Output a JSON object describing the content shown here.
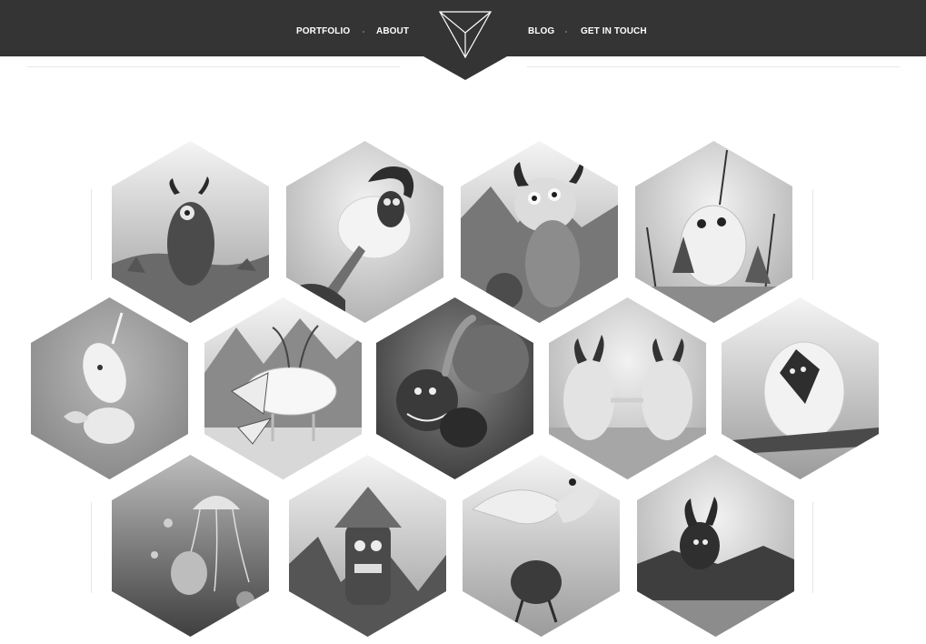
{
  "nav": {
    "portfolio": "PORTFOLIO",
    "about": "ABOUT",
    "blog": "BLOG",
    "contact": "GET IN TOUCH"
  },
  "colors": {
    "header": "#343434",
    "nav_text": "#ffffff",
    "rule": "#e6e6e6"
  },
  "gallery": {
    "style": "grayscale",
    "rows": [
      [
        "one-eyed-horned-monster",
        "sheep-monster-flying",
        "big-eyed-horned-creature-mountains",
        "monster-marionette-puppets"
      ],
      [
        "narwhal-creatures-lying",
        "antlered-beast",
        "tentacle-monster",
        "two-yetis-shaking-hands",
        "hooded-yeti-on-branch"
      ],
      [
        "jellyfish",
        "tiki-mask-monster-mountains",
        "bird-carrying-beetle",
        "horned-monster-on-lake"
      ]
    ]
  }
}
